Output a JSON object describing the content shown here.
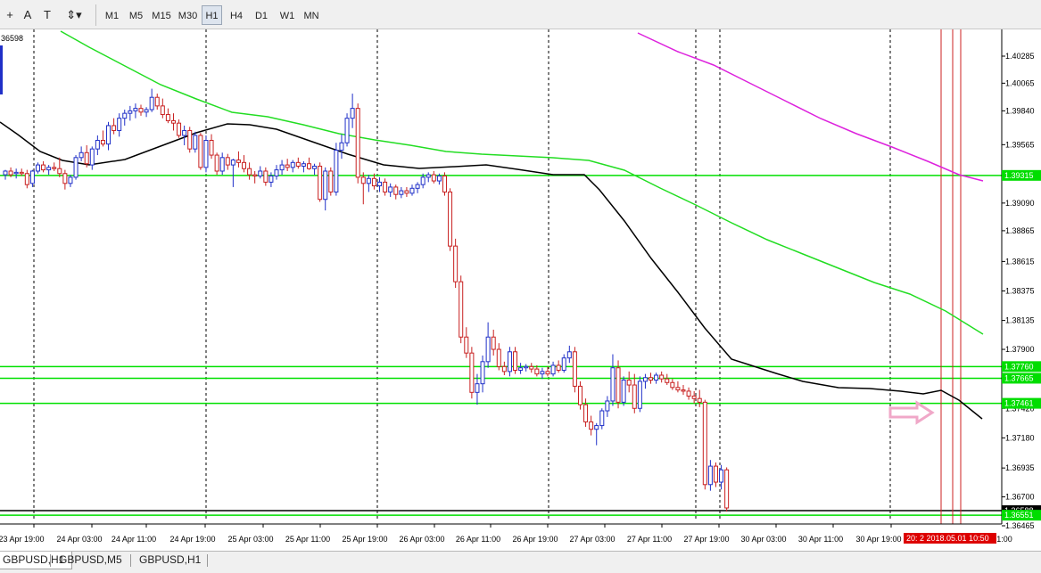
{
  "toolbar": {
    "tools": [
      {
        "name": "crosshair-tool-icon",
        "glyph": "+"
      },
      {
        "name": "text-tool-icon",
        "glyph": "A"
      },
      {
        "name": "text-label-tool-icon",
        "glyph": "T"
      },
      {
        "name": "arrows-tool-icon",
        "glyph": "⇕▾"
      }
    ],
    "timeframes": [
      {
        "label": "M1",
        "active": false
      },
      {
        "label": "M5",
        "active": false
      },
      {
        "label": "M15",
        "active": false
      },
      {
        "label": "M30",
        "active": false
      },
      {
        "label": "H1",
        "active": true
      },
      {
        "label": "H4",
        "active": false
      },
      {
        "label": "D1",
        "active": false
      },
      {
        "label": "W1",
        "active": false
      },
      {
        "label": "MN",
        "active": false
      }
    ]
  },
  "chart": {
    "top_left_label": "36598",
    "price_ticks": [
      "1.40285",
      "1.40065",
      "1.39840",
      "1.39565",
      "1.39315",
      "1.39090",
      "1.38865",
      "1.38615",
      "1.38375",
      "1.38135",
      "1.37900",
      "1.37665",
      "1.37420",
      "1.37180",
      "1.36935",
      "1.36700",
      "1.36465"
    ],
    "time_labels": [
      "23 Apr 19:00",
      "24 Apr 03:00",
      "24 Apr 11:00",
      "24 Apr 19:00",
      "25 Apr 03:00",
      "25 Apr 11:00",
      "25 Apr 19:00",
      "26 Apr 03:00",
      "26 Apr 11:00",
      "26 Apr 19:00",
      "27 Apr 03:00",
      "27 Apr 11:00",
      "27 Apr 19:00",
      "30 Apr 03:00",
      "30 Apr 11:00",
      "30 Apr 19:00",
      "1:00"
    ],
    "time_cursor_label": "20: 2 2018.05.01 10:50",
    "level_labels": [
      {
        "text": "1.39315",
        "price": 1.39315,
        "bg": "#00dd00",
        "fg": "#ffffff"
      },
      {
        "text": "1.37760",
        "price": 1.3776,
        "bg": "#00dd00",
        "fg": "#ffffff"
      },
      {
        "text": "1.37665",
        "price": 1.37665,
        "bg": "#00dd00",
        "fg": "#ffffff"
      },
      {
        "text": "1.37461",
        "price": 1.37461,
        "bg": "#00dd00",
        "fg": "#ffffff"
      },
      {
        "text": "1.36588",
        "price": 1.36588,
        "bg": "#000000",
        "fg": "#ffffff"
      },
      {
        "text": "1.36551",
        "price": 1.36551,
        "bg": "#00dd00",
        "fg": "#ffffff"
      }
    ],
    "colors": {
      "bull": "#2030c8",
      "bear": "#c82020",
      "level": "#00e000",
      "ma_fast": "#000000",
      "ma_mid": "#22dd22",
      "ma_slow": "#dd22dd",
      "vertical_red": "#cc2020",
      "arrow": "#f0a8c8"
    }
  },
  "tabs": [
    {
      "label": "GBPUSD,H1",
      "active": true
    },
    {
      "label": "GBPUSD,M5",
      "active": false
    },
    {
      "label": "GBPUSD,H1",
      "active": false
    }
  ]
}
